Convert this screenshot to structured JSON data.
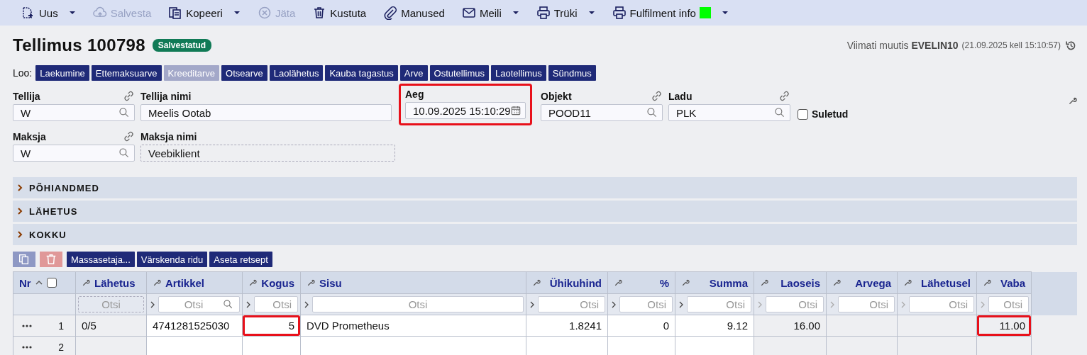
{
  "toolbar": [
    {
      "label": "Uus",
      "disabled": false,
      "menu": true
    },
    {
      "label": "Salvesta",
      "disabled": true,
      "menu": false
    },
    {
      "label": "Kopeeri",
      "disabled": false,
      "menu": true
    },
    {
      "label": "Jäta",
      "disabled": true,
      "menu": false
    },
    {
      "label": "Kustuta",
      "disabled": false,
      "menu": false
    },
    {
      "label": "Manused",
      "disabled": false,
      "menu": false
    },
    {
      "label": "Meili",
      "disabled": false,
      "menu": true
    },
    {
      "label": "Trüki",
      "disabled": false,
      "menu": true
    },
    {
      "label": "Fulfilment info",
      "disabled": false,
      "menu": true,
      "color": "#00ff00"
    }
  ],
  "header": {
    "title": "Tellimus 100798",
    "status": "Salvestatud",
    "modified": "Viimati muutis **EVELIN10**",
    "modified_time": "(21.09.2025 kell 15:10:57)"
  },
  "create": {
    "label": "Loo:",
    "buttons": [
      {
        "label": "Laekumine",
        "disabled": false
      },
      {
        "label": "Ettemaksuarve",
        "disabled": false
      },
      {
        "label": "Kreeditarve",
        "disabled": true
      },
      {
        "label": "Otsearve",
        "disabled": false
      },
      {
        "label": "Laolähetus",
        "disabled": false
      },
      {
        "label": "Kauba tagastus",
        "disabled": false
      },
      {
        "label": "Arve",
        "disabled": false
      },
      {
        "label": "Ostutellimus",
        "disabled": false
      },
      {
        "label": "Laotellimus",
        "disabled": false
      },
      {
        "label": "Sündmus",
        "disabled": false
      }
    ]
  },
  "field_rows": [
    [
      {
        "kind": "lookup",
        "label": "Tellija",
        "value": "W",
        "linked": true,
        "highlighted": false
      },
      {
        "kind": "text",
        "label": "Tellija nimi",
        "value": "Meelis Ootab",
        "linked": false,
        "highlighted": false
      },
      {
        "kind": "date",
        "label": "Aeg",
        "value": "10.09.2025 15:10:29",
        "linked": false,
        "highlighted": true
      },
      {
        "kind": "lookup",
        "label": "Objekt",
        "value": "POOD11",
        "linked": true,
        "highlighted": false
      },
      {
        "kind": "lookup",
        "label": "Ladu",
        "value": "PLK",
        "linked": true,
        "highlighted": false
      },
      {
        "kind": "checkbox",
        "label": "Suletud",
        "checked": false
      }
    ],
    [
      {
        "kind": "lookup",
        "label": "Maksja",
        "value": "W",
        "linked": true,
        "highlighted": false
      },
      {
        "kind": "readonly",
        "label": "Maksja nimi",
        "value": "Veebiklient",
        "linked": false,
        "highlighted": false
      }
    ]
  ],
  "sections": [
    {
      "label": "PÕHIANDMED",
      "expanded": false
    },
    {
      "label": "LÄHETUS",
      "expanded": false
    },
    {
      "label": "KOKKU",
      "expanded": false
    }
  ],
  "row_actions": [
    "Massasetaja...",
    "Värskenda ridu",
    "Aseta retsept"
  ],
  "table": {
    "select_all": {
      "checked": false
    },
    "columns": [
      {
        "kind": "nr",
        "label": "Nr"
      },
      {
        "kind": "status",
        "label": "Lähetus",
        "placeholder": "Otsi"
      },
      {
        "kind": "article",
        "label": "Artikkel",
        "placeholder": "Otsi"
      },
      {
        "kind": "number",
        "label": "Kogus",
        "placeholder": "Otsi"
      },
      {
        "kind": "text",
        "label": "Sisu",
        "placeholder": "Otsi"
      },
      {
        "kind": "number",
        "label": "Ühikuhind",
        "placeholder": "Otsi"
      },
      {
        "kind": "number",
        "label": "%",
        "placeholder": "Otsi"
      },
      {
        "kind": "number",
        "label": "Summa",
        "placeholder": "Otsi"
      },
      {
        "kind": "stock",
        "label": "Laoseis",
        "placeholder": "Otsi"
      },
      {
        "kind": "stock",
        "label": "Arvega",
        "placeholder": "Otsi"
      },
      {
        "kind": "stock",
        "label": "Lähetusel",
        "placeholder": "Otsi"
      },
      {
        "kind": "stock",
        "label": "Vaba",
        "placeholder": "Otsi"
      }
    ],
    "rows": [
      {
        "cells": [
          {
            "value": "1",
            "highlighted": false
          },
          {
            "value": "0/5",
            "highlighted": false
          },
          {
            "value": "4741281525030",
            "highlighted": false
          },
          {
            "value": "5",
            "highlighted": true
          },
          {
            "value": "DVD Prometheus",
            "highlighted": false
          },
          {
            "value": "1.8241",
            "highlighted": false
          },
          {
            "value": "0",
            "highlighted": false
          },
          {
            "value": "9.12",
            "highlighted": false
          },
          {
            "value": "16.00",
            "highlighted": false
          },
          null,
          null,
          {
            "value": "11.00",
            "highlighted": true
          }
        ]
      },
      {
        "cells": [
          {
            "value": "2",
            "highlighted": false
          }
        ]
      }
    ]
  }
}
